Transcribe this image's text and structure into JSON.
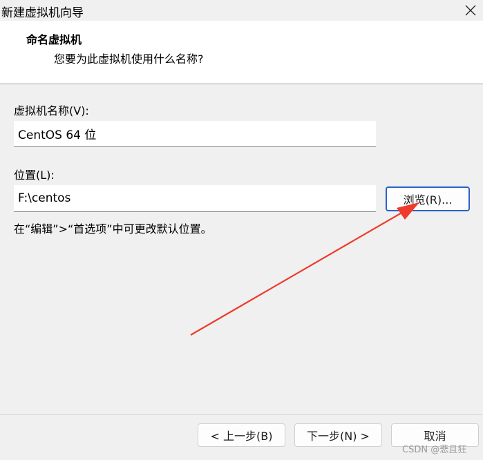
{
  "window": {
    "title": "新建虚拟机向导"
  },
  "header": {
    "title": "命名虚拟机",
    "subtitle": "您要为此虚拟机使用什么名称?"
  },
  "name_field": {
    "label": "虚拟机名称(V):",
    "value": "CentOS 64 位"
  },
  "location_field": {
    "label": "位置(L):",
    "value": "F:\\centos"
  },
  "browse_button": {
    "label": "浏览(R)..."
  },
  "hint": "在“编辑”>“首选项”中可更改默认位置。",
  "nav": {
    "back": "< 上一步(B)",
    "next": "下一步(N) >",
    "cancel": "取消"
  },
  "watermark": "CSDN @悲且狂",
  "colors": {
    "arrow": "#ee3b2c",
    "focus_border": "#2a62c9",
    "header_bg": "#ffffff",
    "body_bg": "#f0f0f0"
  }
}
